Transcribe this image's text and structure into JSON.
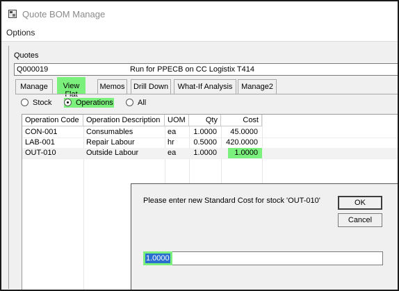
{
  "window": {
    "title": "Quote BOM Manage"
  },
  "menu": {
    "options": "Options"
  },
  "quotes": {
    "label": "Quotes",
    "code": "Q000019",
    "description": "Run for PPECB on CC Logistix T414"
  },
  "tabs": [
    {
      "label": "Manage"
    },
    {
      "label": "View Flat"
    },
    {
      "label": "Memos"
    },
    {
      "label": "Drill Down"
    },
    {
      "label": "What-If Analysis"
    },
    {
      "label": "Manage2"
    }
  ],
  "view_filter": {
    "stock": "Stock",
    "operations": "Operations",
    "all": "All",
    "selected": "Operations"
  },
  "grid": {
    "columns": [
      "Operation Code",
      "Operation Description",
      "UOM",
      "Qty",
      "Cost"
    ],
    "rows": [
      {
        "code": "CON-001",
        "description": "Consumables",
        "uom": "ea",
        "qty": "1.0000",
        "cost": "45.0000"
      },
      {
        "code": "LAB-001",
        "description": "Repair Labour",
        "uom": "hr",
        "qty": "0.5000",
        "cost": "420.0000"
      },
      {
        "code": "OUT-010",
        "description": "Outside Labour",
        "uom": "ea",
        "qty": "1.0000",
        "cost": "1.0000"
      }
    ]
  },
  "dialog": {
    "prompt": "Please enter new Standard Cost for stock 'OUT-010'",
    "ok_label": "OK",
    "cancel_label": "Cancel",
    "value": "1.0000"
  },
  "colors": {
    "highlight": "#7cf07c",
    "selection": "#2a6fd0"
  }
}
